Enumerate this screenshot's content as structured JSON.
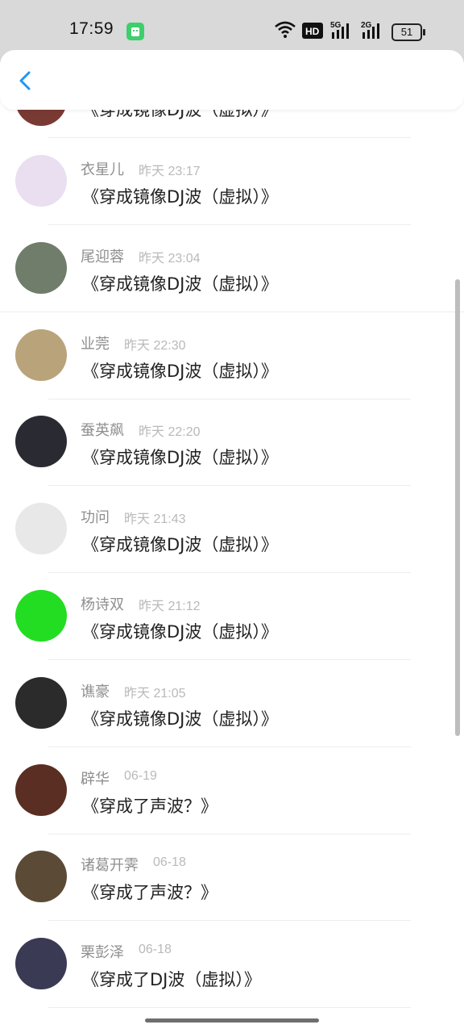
{
  "status_bar": {
    "time": "17:59",
    "battery": "51",
    "icons": [
      "wifi-icon",
      "hd-icon",
      "5g-signal-icon",
      "2g-signal-icon",
      "battery-icon"
    ]
  },
  "nav": {
    "back_icon": "chevron-left-icon"
  },
  "partial_row": {
    "content": "《穿成镜像DJ波（虚拟）》"
  },
  "comments": [
    {
      "name": "衣星儿",
      "time": "昨天 23:17",
      "content": "《穿成镜像DJ波（虚拟）》",
      "avatar_color": "#e9dff0"
    },
    {
      "name": "尾迎蓉",
      "time": "昨天 23:04",
      "content": "《穿成镜像DJ波（虚拟）》",
      "avatar_color": "#6f7d6a"
    },
    {
      "name": "业莞",
      "time": "昨天 22:30",
      "content": "《穿成镜像DJ波（虚拟）》",
      "avatar_color": "#b9a37a"
    },
    {
      "name": "蚕英飙",
      "time": "昨天 22:20",
      "content": "《穿成镜像DJ波（虚拟）》",
      "avatar_color": "#2a2a32"
    },
    {
      "name": "功问",
      "time": "昨天 21:43",
      "content": "《穿成镜像DJ波（虚拟）》",
      "avatar_color": "#e8e8e8"
    },
    {
      "name": "杨诗双",
      "time": "昨天 21:12",
      "content": "《穿成镜像DJ波（虚拟）》",
      "avatar_color": "#22dd22"
    },
    {
      "name": "谯豪",
      "time": "昨天 21:05",
      "content": "《穿成镜像DJ波（虚拟）》",
      "avatar_color": "#2b2b2b"
    },
    {
      "name": "辟华",
      "time": "06-19",
      "content": "《穿成了声波？》",
      "avatar_color": "#5a2e22"
    },
    {
      "name": "诸葛开霁",
      "time": "06-18",
      "content": "《穿成了声波？》",
      "avatar_color": "#5b4a36"
    },
    {
      "name": "栗彭泽",
      "time": "06-18",
      "content": "《穿成了DJ波（虚拟）》",
      "avatar_color": "#3a3a55"
    }
  ]
}
